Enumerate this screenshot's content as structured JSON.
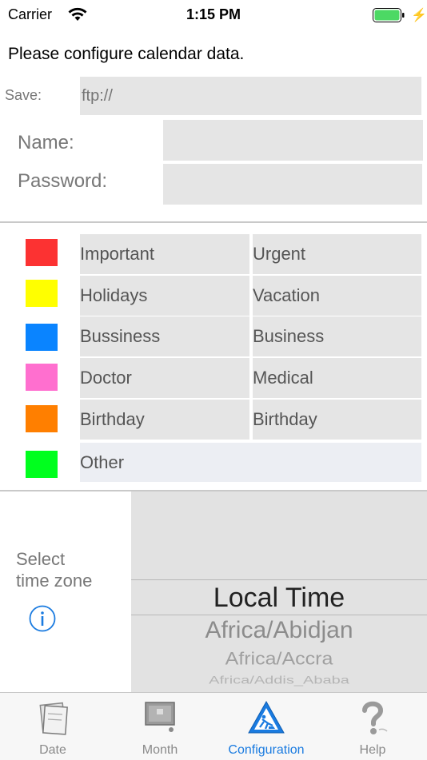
{
  "status_bar": {
    "carrier": "Carrier",
    "time": "1:15 PM",
    "battery_color": "#4cd964"
  },
  "prompt": "Please configure calendar data.",
  "form": {
    "save_label": "Save:",
    "save_placeholder": "ftp://",
    "save_value": "",
    "name_label": "Name:",
    "name_value": "",
    "password_label": "Password:",
    "password_value": ""
  },
  "categories": [
    {
      "color": "#fc3232",
      "name": "Important",
      "value": "Urgent"
    },
    {
      "color": "#ffff00",
      "name": "Holidays",
      "value": "Vacation"
    },
    {
      "color": "#0a84ff",
      "name": "Bussiness",
      "value": "Business"
    },
    {
      "color": "#ff6fcf",
      "name": "Doctor",
      "value": "Medical"
    },
    {
      "color": "#ff7f00",
      "name": "Birthday",
      "value": "Birthday"
    },
    {
      "color": "#00ff1e",
      "name": "Other"
    }
  ],
  "timezone": {
    "label_line1": "Select",
    "label_line2": "time zone",
    "info_icon": "info-icon",
    "options": [
      "Local Time",
      "Africa/Abidjan",
      "Africa/Accra",
      "Africa/Addis_Ababa"
    ],
    "selected": "Local Time"
  },
  "tabbar": {
    "accent_color": "#1a7be0",
    "tabs": [
      {
        "label": "Date",
        "icon": "notepad-icon",
        "active": false
      },
      {
        "label": "Month",
        "icon": "calendar-board-icon",
        "active": false
      },
      {
        "label": "Configuration",
        "icon": "construction-sign-icon",
        "active": true
      },
      {
        "label": "Help",
        "icon": "question-mark-icon",
        "active": false
      }
    ]
  }
}
